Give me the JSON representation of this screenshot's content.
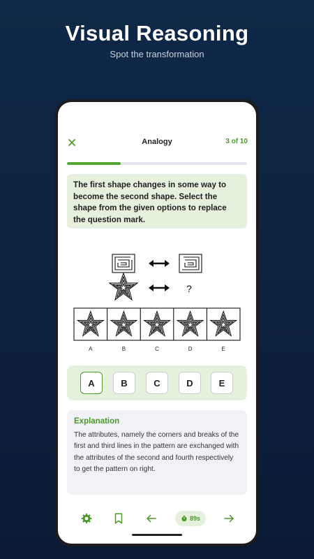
{
  "promo": {
    "title": "Visual Reasoning",
    "subtitle": "Spot the transformation"
  },
  "header": {
    "title": "Analogy",
    "count": "3 of 10"
  },
  "progress": {
    "fraction": 0.3
  },
  "question": {
    "text": "The first shape changes in some way to become the second shape. Select the shape from the given options to replace the question mark."
  },
  "puzzle": {
    "question_mark": "?",
    "figure_labels": [
      "A",
      "B",
      "C",
      "D",
      "E"
    ]
  },
  "options": {
    "items": [
      "A",
      "B",
      "C",
      "D",
      "E"
    ],
    "selected": "A"
  },
  "explanation": {
    "title": "Explanation",
    "body": "The attributes, namely the corners and breaks of the first and third lines in the pattern are exchanged with the attributes of the second and fourth respectively to get the pattern on right."
  },
  "bottom_bar": {
    "icons": [
      "gear-icon",
      "bookmark-icon",
      "arrow-left-icon",
      "stopwatch-icon",
      "arrow-right-icon"
    ],
    "timer": "89s"
  },
  "colors": {
    "accent": "#4a9a28",
    "accent_light": "#e5f1dd",
    "background": "#0f2847"
  }
}
